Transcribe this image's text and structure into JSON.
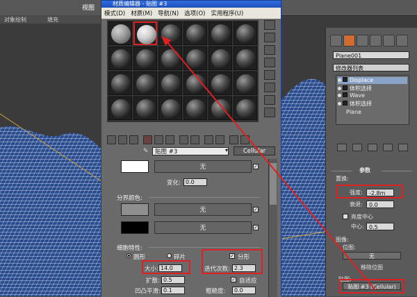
{
  "viewport": {
    "toolbar_label": "视图",
    "sub_labels": [
      "对象绘制",
      "填充"
    ]
  },
  "material_editor": {
    "title": "材质编辑器 - 贴图 #3",
    "menu": [
      "模式(D)",
      "材质(M)",
      "导航(N)",
      "选项(O)",
      "实用程序(U)"
    ],
    "material_name": "贴图 #3",
    "material_type": "Cellular",
    "rollout": {
      "none_label": "无",
      "variation_label": "变化:",
      "variation_value": "0.0",
      "division_colors_label": "分界颜色:",
      "cell_char_label": "细胞特性:",
      "circular_label": "圆形",
      "chips_label": "碎片",
      "fractal_label": "分形",
      "size_label": "大小:",
      "size_value": "14.0",
      "iterations_label": "迭代次数:",
      "iterations_value": "2.3",
      "spread_label": "扩散:",
      "spread_value": "0.5",
      "adaptive_label": "自适应",
      "bump_smooth_label": "凹凸平滑:",
      "bump_smooth_value": "0.1",
      "roughness_label": "粗糙度:",
      "roughness_value": "0.0"
    }
  },
  "command_panel": {
    "object_name": "Plane001",
    "modifier_list": "修改器列表",
    "stack": [
      "Displace",
      "体积选择",
      "Wave",
      "体积选择",
      "Plane"
    ],
    "params_title": "参数",
    "displacement_label": "置换:",
    "strength_label": "强度:",
    "strength_value": "-2.8m",
    "decay_label": "衰退:",
    "decay_value": "0.0",
    "luminance_center_label": "亮度中心",
    "center_label": "中心:",
    "center_value": "0.5",
    "image_label": "图像:",
    "bitmap_label": "位图:",
    "none_label": "无",
    "remove_bitmap_label": "移除位图",
    "map_label": "贴图:",
    "map_value": "贴图 #3 (Cellular)"
  },
  "colors": {
    "highlight": "#e02020",
    "mesh": "#d8e4ff",
    "title_bar": "#2f6de3"
  }
}
